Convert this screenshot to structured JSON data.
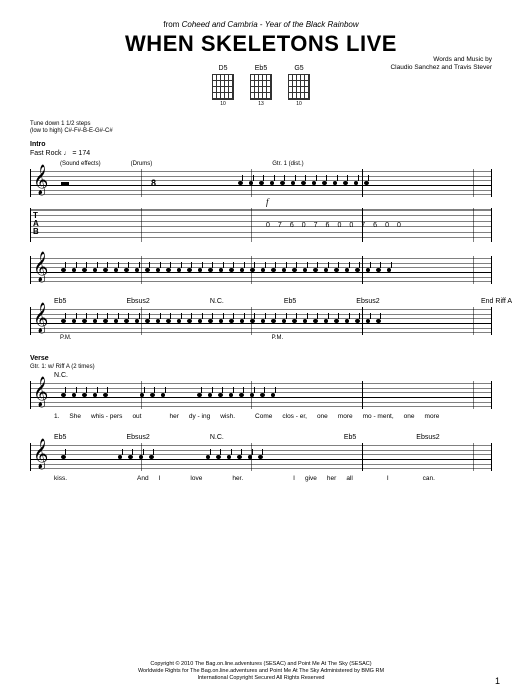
{
  "header": {
    "from": "from",
    "artist": "Coheed and Cambria",
    "sep": "-",
    "album": "Year of the Black Rainbow",
    "title": "WHEN SKELETONS LIVE"
  },
  "credits": {
    "line1": "Words and Music by",
    "line2": "Claudio Sanchez and Travis Stever"
  },
  "chord_diagrams": [
    {
      "name": "D5",
      "fret": "10"
    },
    {
      "name": "Eb5",
      "fret": "13"
    },
    {
      "name": "G5",
      "fret": "10"
    }
  ],
  "tuning": {
    "line1": "Tune down 1 1/2 steps",
    "line2": "(low to high) C#-F#-B-E-G#-C#"
  },
  "sections": {
    "intro": "Intro",
    "tempo": "Fast Rock ♩ = 174",
    "verse": "Verse"
  },
  "annotations": {
    "sound_effects": "(Sound effects)",
    "drums": "(Drums)",
    "gtr1_dist": "Gtr. 1 (dist.)",
    "dynamic_f": "f",
    "end_riff_a": "End Riff A",
    "pm": "P.M.",
    "gtr1_riff": "Gtr. 1: w/ Riff A (2 times)"
  },
  "chords": {
    "eb5": "Eb5",
    "ebsus2": "Ebsus2",
    "nc": "N.C."
  },
  "tab": {
    "label_t": "T",
    "label_a": "A",
    "label_b": "B",
    "intro_nums": [
      "0",
      "7",
      "6",
      "0",
      "7",
      "6",
      "0",
      "0",
      "7",
      "6",
      "0",
      "0"
    ]
  },
  "lyrics": {
    "verse1_num": "1.",
    "verse1": [
      "She",
      "whis - pers",
      "out",
      "her",
      "dy - ing",
      "wish.",
      "Come",
      "clos - er,",
      "one",
      "more",
      "mo - ment,",
      "one",
      "more"
    ],
    "verse2": [
      "kiss.",
      "And",
      "I",
      "love",
      "her.",
      "I",
      "give",
      "her",
      "all",
      "I",
      "can."
    ]
  },
  "rests": {
    "whole": "8"
  },
  "footer": {
    "line1": "Copyright © 2010 The Bag.on.line.adventures (SESAC) and Point Me At The Sky (SESAC)",
    "line2": "Worldwide Rights for The Bag.on.line.adventures and Point Me At The Sky Administered by BMG RM",
    "line3": "International Copyright Secured   All Rights Reserved"
  },
  "page": "1"
}
